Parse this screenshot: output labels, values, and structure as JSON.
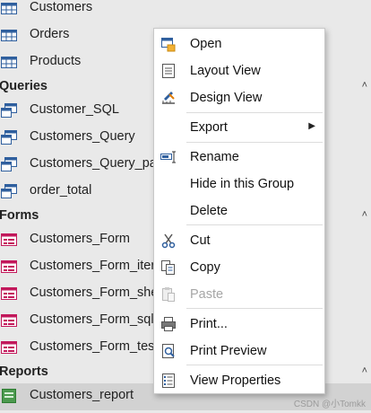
{
  "nav": {
    "tables": [
      {
        "label": "Customers",
        "icon": "table-icon"
      },
      {
        "label": "Orders",
        "icon": "table-icon"
      },
      {
        "label": "Products",
        "icon": "table-icon"
      }
    ],
    "groups": {
      "queries": {
        "label": "Queries"
      },
      "forms": {
        "label": "Forms"
      },
      "reports": {
        "label": "Reports"
      }
    },
    "queries": [
      {
        "label": "Customer_SQL"
      },
      {
        "label": "Customers_Query"
      },
      {
        "label": "Customers_Query_pa"
      },
      {
        "label": "order_total"
      }
    ],
    "forms": [
      {
        "label": "Customers_Form"
      },
      {
        "label": "Customers_Form_iter"
      },
      {
        "label": "Customers_Form_she"
      },
      {
        "label": "Customers_Form_sqli"
      },
      {
        "label": "Customers_Form_test"
      }
    ],
    "reports": [
      {
        "label": "Customers_report"
      }
    ]
  },
  "context_menu": {
    "items": [
      {
        "label": "Open",
        "icon": "open-icon",
        "enabled": true
      },
      {
        "label": "Layout View",
        "icon": "layout-view-icon",
        "enabled": true
      },
      {
        "label": "Design View",
        "icon": "design-view-icon",
        "enabled": true
      },
      {
        "label": "Export",
        "icon": "",
        "enabled": true,
        "submenu": true
      },
      {
        "label": "Rename",
        "icon": "rename-icon",
        "enabled": true
      },
      {
        "label": "Hide in this Group",
        "icon": "",
        "enabled": true
      },
      {
        "label": "Delete",
        "icon": "",
        "enabled": true
      },
      {
        "label": "Cut",
        "icon": "scissors-icon",
        "enabled": true
      },
      {
        "label": "Copy",
        "icon": "copy-icon",
        "enabled": true
      },
      {
        "label": "Paste",
        "icon": "paste-icon",
        "enabled": false
      },
      {
        "label": "Print...",
        "icon": "printer-icon",
        "enabled": true
      },
      {
        "label": "Print Preview",
        "icon": "print-preview-icon",
        "enabled": true
      },
      {
        "label": "View Properties",
        "icon": "properties-icon",
        "enabled": true
      }
    ]
  },
  "watermark": "CSDN @小Tomkk",
  "colors": {
    "table_icon": "#2f5f9e",
    "query_icon": "#2f5f9e",
    "form_icon": "#c2185b",
    "report_icon": "#2e7d32"
  }
}
